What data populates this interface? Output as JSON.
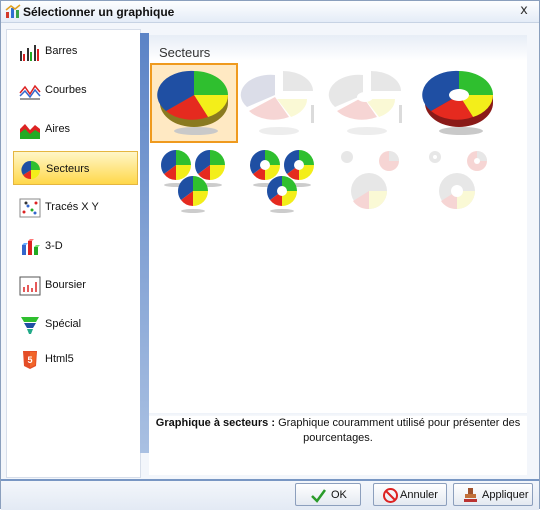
{
  "window": {
    "title": "Sélectionner un graphique",
    "close_glyph": "x"
  },
  "sidebar": {
    "items": [
      {
        "label": "Barres",
        "icon": "bar-chart-icon"
      },
      {
        "label": "Courbes",
        "icon": "line-chart-icon"
      },
      {
        "label": "Aires",
        "icon": "area-chart-icon"
      },
      {
        "label": "Secteurs",
        "icon": "pie-chart-icon",
        "selected": true
      },
      {
        "label": "Tracés X Y",
        "icon": "scatter-chart-icon"
      },
      {
        "label": "3-D",
        "icon": "3d-chart-icon"
      },
      {
        "label": "Boursier",
        "icon": "stock-chart-icon"
      },
      {
        "label": "Spécial",
        "icon": "funnel-chart-icon"
      },
      {
        "label": "Html5",
        "icon": "html5-icon"
      }
    ]
  },
  "panel": {
    "title": "Secteurs"
  },
  "description": {
    "term": "Graphique à secteurs :",
    "text": " Graphique couramment utilisé pour présenter des pourcentages."
  },
  "buttons": {
    "ok": "OK",
    "cancel": "Annuler",
    "apply": "Appliquer"
  },
  "colors": {
    "accent": "#ef9a1e",
    "pie_blue": "#1f4fa3",
    "pie_green": "#2fbf2f",
    "pie_yellow": "#f3ee1a",
    "pie_red": "#e52a1f"
  }
}
